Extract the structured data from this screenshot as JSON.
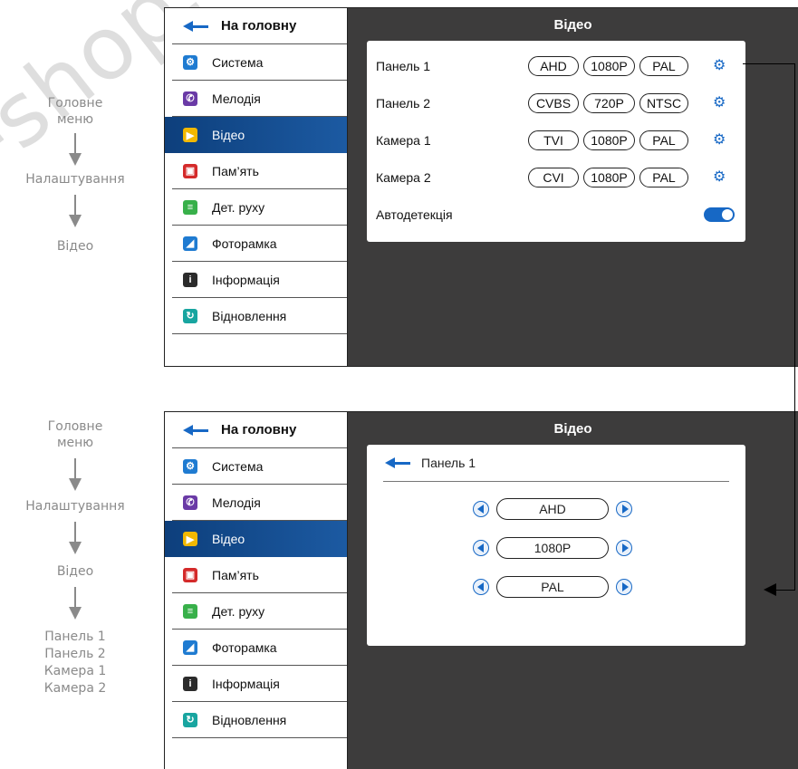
{
  "watermark": "-shop.co",
  "flow_top": [
    "Головне\nменю",
    "Налаштування",
    "Відео"
  ],
  "flow_bottom": [
    "Головне\nменю",
    "Налаштування",
    "Відео",
    "Панель 1\nПанель 2\nКамера 1\nКамера 2"
  ],
  "sidebar": {
    "home": "На головну",
    "items": [
      {
        "label": "Система",
        "icon": "gear-icon",
        "color": "#1f7bd1"
      },
      {
        "label": "Мелодія",
        "icon": "phone-icon",
        "color": "#6a3aa6"
      },
      {
        "label": "Відео",
        "icon": "play-icon",
        "color": "#f2b800"
      },
      {
        "label": "Пам’ять",
        "icon": "memory-icon",
        "color": "#d42a2a"
      },
      {
        "label": "Дет. руху",
        "icon": "motion-icon",
        "color": "#38b04a"
      },
      {
        "label": "Фоторамка",
        "icon": "picture-icon",
        "color": "#1f7bd1"
      },
      {
        "label": "Інформація",
        "icon": "info-icon",
        "color": "#2b2b2b"
      },
      {
        "label": "Відновлення",
        "icon": "restore-icon",
        "color": "#18a5a0"
      }
    ]
  },
  "video_title": "Відео",
  "video_rows": [
    {
      "label": "Панель 1",
      "fmt": "AHD",
      "res": "1080P",
      "std": "PAL"
    },
    {
      "label": "Панель 2",
      "fmt": "CVBS",
      "res": "720P",
      "std": "NTSC"
    },
    {
      "label": "Камера 1",
      "fmt": "TVI",
      "res": "1080P",
      "std": "PAL"
    },
    {
      "label": "Камера 2",
      "fmt": "CVI",
      "res": "1080P",
      "std": "PAL"
    }
  ],
  "autodetect": {
    "label": "Автодетекція",
    "on": true
  },
  "detail": {
    "title": "Панель 1",
    "selectors": [
      "AHD",
      "1080P",
      "PAL"
    ]
  },
  "colors": {
    "accent": "#1768c5",
    "active_bg": "#134b8f",
    "dark_bg": "#3d3c3c"
  }
}
